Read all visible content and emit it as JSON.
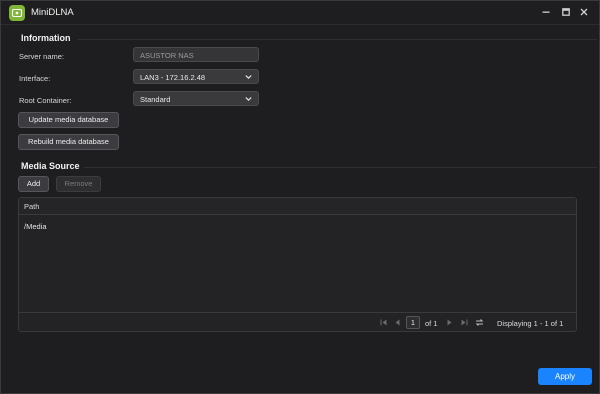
{
  "window": {
    "title": "MiniDLNA"
  },
  "information": {
    "heading": "Information",
    "server_name_label": "Server name:",
    "server_name_value": "ASUSTOR NAS",
    "interface_label": "Interface:",
    "interface_value": "LAN3 - 172.16.2.48",
    "root_container_label": "Root Container:",
    "root_container_value": "Standard",
    "update_button": "Update media database",
    "rebuild_button": "Rebuild media database"
  },
  "media_source": {
    "heading": "Media Source",
    "add_button": "Add",
    "remove_button": "Remove",
    "columns": [
      "Path"
    ],
    "rows": [
      {
        "path": "/Media"
      }
    ],
    "pager": {
      "current_page": "1",
      "of_text": "of 1",
      "displaying": "Displaying 1 - 1 of 1"
    }
  },
  "footer": {
    "apply_button": "Apply"
  },
  "colors": {
    "accent": "#1a84ff",
    "app_icon": "#7fb636",
    "background": "#1e1e20"
  }
}
